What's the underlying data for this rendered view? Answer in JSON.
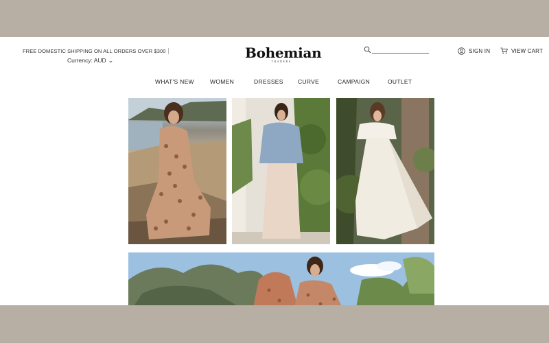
{
  "topbar": {
    "shipping_text": "FREE DOMESTIC SHIPPING ON ALL ORDERS OVER $300",
    "currency_label": "Currency: AUD",
    "chevron_icon": "chevron-down-icon"
  },
  "logo": {
    "brand": "Bohemian",
    "tagline": "TRADERS"
  },
  "search": {
    "icon": "search-icon",
    "value": "",
    "placeholder": ""
  },
  "account": {
    "icon": "user-icon",
    "label": "SIGN IN"
  },
  "cart": {
    "icon": "cart-icon",
    "label": "VIEW CART"
  },
  "nav": {
    "items": [
      {
        "label": "WHAT'S NEW"
      },
      {
        "label": "WOMEN"
      },
      {
        "label": "DRESSES"
      },
      {
        "label": "CURVE"
      },
      {
        "label": "CAMPAIGN"
      },
      {
        "label": "OUTLET"
      }
    ]
  },
  "colors": {
    "frame_bg": "#b7afa4",
    "page_bg": "#ffffff",
    "text": "#222222"
  }
}
